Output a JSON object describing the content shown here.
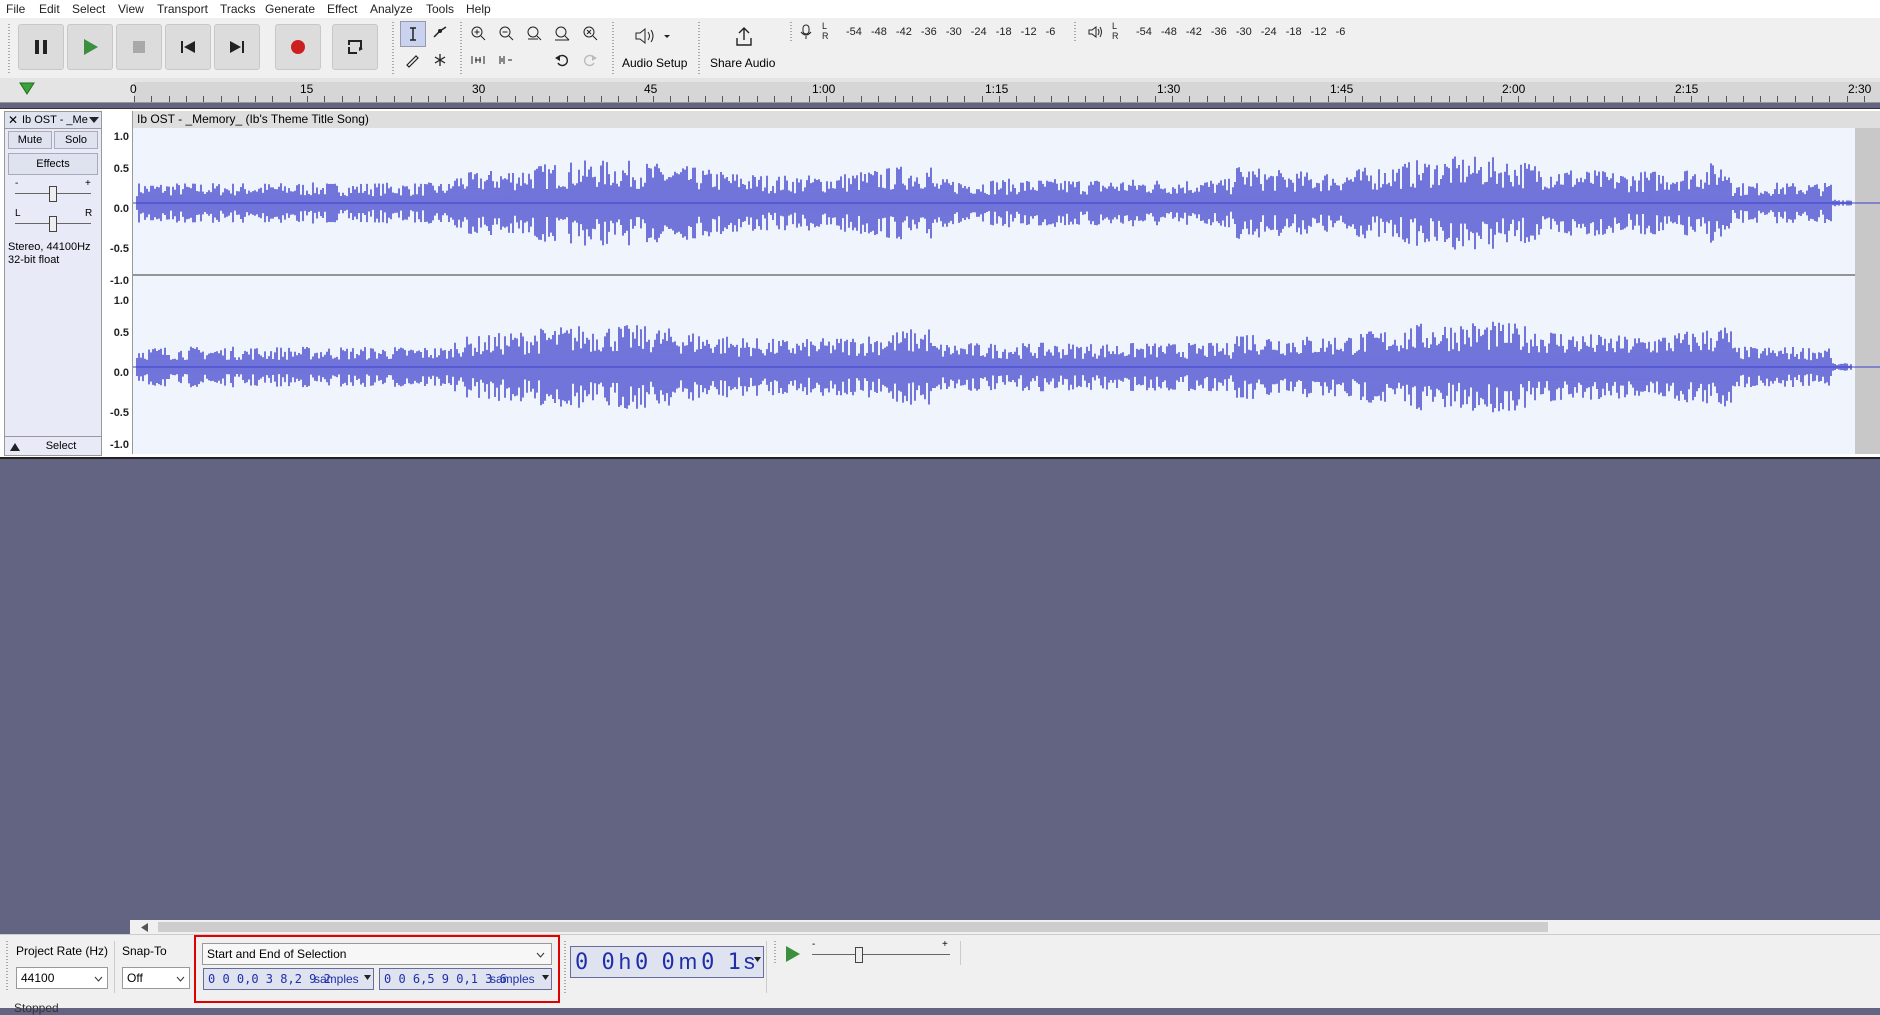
{
  "menu": [
    "File",
    "Edit",
    "Select",
    "View",
    "Transport",
    "Tracks",
    "Generate",
    "Effect",
    "Analyze",
    "Tools",
    "Help"
  ],
  "toolbar": {
    "audio_setup_label": "Audio Setup",
    "share_audio_label": "Share Audio",
    "rec_meter_ticks": "-54 -48 -42 -36 -30 -24 -18 -12 -6",
    "play_meter_ticks": "-54 -48 -42 -36 -30 -24 -18 -12 -6",
    "meter_lr": [
      "L",
      "R"
    ]
  },
  "ruler": {
    "labels": [
      "0",
      "15",
      "30",
      "45",
      "1:00",
      "1:15",
      "1:30",
      "1:45",
      "2:00",
      "2:15",
      "2:30"
    ]
  },
  "track": {
    "name": "Ib OST - _Me",
    "title": "Ib OST - _Memory_ (Ib's Theme  Title Song)",
    "mute": "Mute",
    "solo": "Solo",
    "effects": "Effects",
    "gain_minus": "-",
    "gain_plus": "+",
    "pan_l": "L",
    "pan_r": "R",
    "info_line1": "Stereo, 44100Hz",
    "info_line2": "32-bit float",
    "select": "Select",
    "vruler_top": [
      "1.0",
      "0.5",
      "0.0",
      "-0.5",
      "-1.0"
    ],
    "vruler_bottom": [
      "1.0",
      "0.5",
      "0.0",
      "-0.5",
      "-1.0"
    ],
    "wave_color": "#3b3fcc"
  },
  "bottom": {
    "project_rate_label": "Project Rate (Hz)",
    "project_rate_value": "44100",
    "snap_to_label": "Snap-To",
    "snap_to_value": "Off",
    "selection_mode": "Start and End of Selection",
    "selection_start": "0 0 0,0 3 8,2 9 2",
    "selection_end": "0 0 6,5 9 0,1 3 6",
    "samples_unit": "samples",
    "time_h": "0 0",
    "time_m": "0 0",
    "time_s": "0 1",
    "time_h_unit": "h",
    "time_m_unit": "m",
    "time_s_unit": "s",
    "status": "Stopped"
  },
  "highlight_color": "#e00000"
}
